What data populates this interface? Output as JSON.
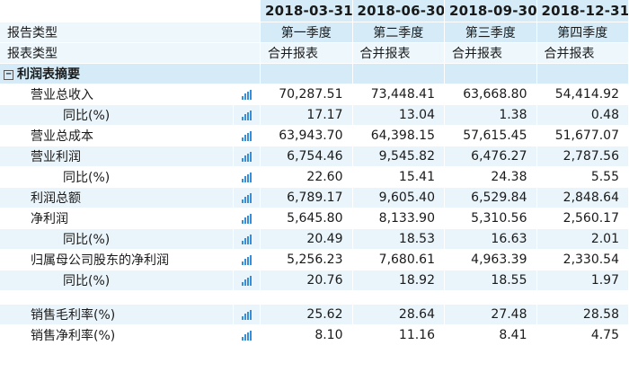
{
  "periods": [
    "2018-03-31",
    "2018-06-30",
    "2018-09-30",
    "2018-12-31"
  ],
  "report_type": {
    "label": "报告类型",
    "values": [
      "第一季度",
      "第二季度",
      "第三季度",
      "第四季度"
    ]
  },
  "statement_type": {
    "label": "报表类型",
    "values": [
      "合并报表",
      "合并报表",
      "合并报表",
      "合并报表"
    ]
  },
  "group": {
    "label": "利润表摘要",
    "toggle": "−"
  },
  "rows": [
    {
      "label": "营业总收入",
      "values": [
        "70,287.51",
        "73,448.41",
        "63,668.80",
        "54,414.92"
      ]
    },
    {
      "label": "同比(%)",
      "values": [
        "17.17",
        "13.04",
        "1.38",
        "0.48"
      ]
    },
    {
      "label": "营业总成本",
      "values": [
        "63,943.70",
        "64,398.15",
        "57,615.45",
        "51,677.07"
      ]
    },
    {
      "label": "营业利润",
      "values": [
        "6,754.46",
        "9,545.82",
        "6,476.27",
        "2,787.56"
      ]
    },
    {
      "label": "同比(%)",
      "values": [
        "22.60",
        "15.41",
        "24.38",
        "5.55"
      ]
    },
    {
      "label": "利润总额",
      "values": [
        "6,789.17",
        "9,605.40",
        "6,529.84",
        "2,848.64"
      ]
    },
    {
      "label": "净利润",
      "values": [
        "5,645.80",
        "8,133.90",
        "5,310.56",
        "2,560.17"
      ]
    },
    {
      "label": "同比(%)",
      "values": [
        "20.49",
        "18.53",
        "16.63",
        "2.01"
      ]
    },
    {
      "label": "归属母公司股东的净利润",
      "values": [
        "5,256.23",
        "7,680.61",
        "4,963.39",
        "2,330.54"
      ]
    },
    {
      "label": "同比(%)",
      "values": [
        "20.76",
        "18.92",
        "18.55",
        "1.97"
      ]
    }
  ],
  "ratios": [
    {
      "label": "销售毛利率(%)",
      "values": [
        "25.62",
        "28.64",
        "27.48",
        "28.58"
      ]
    },
    {
      "label": "销售净利率(%)",
      "values": [
        "8.10",
        "11.16",
        "8.41",
        "4.75"
      ]
    }
  ],
  "colors": {
    "header_bg": "#d5ecf8",
    "stripe_bg": "#eaf5fb",
    "chart_icon": "#3a8ed6"
  },
  "chart_icon_name": "bar-chart-icon"
}
